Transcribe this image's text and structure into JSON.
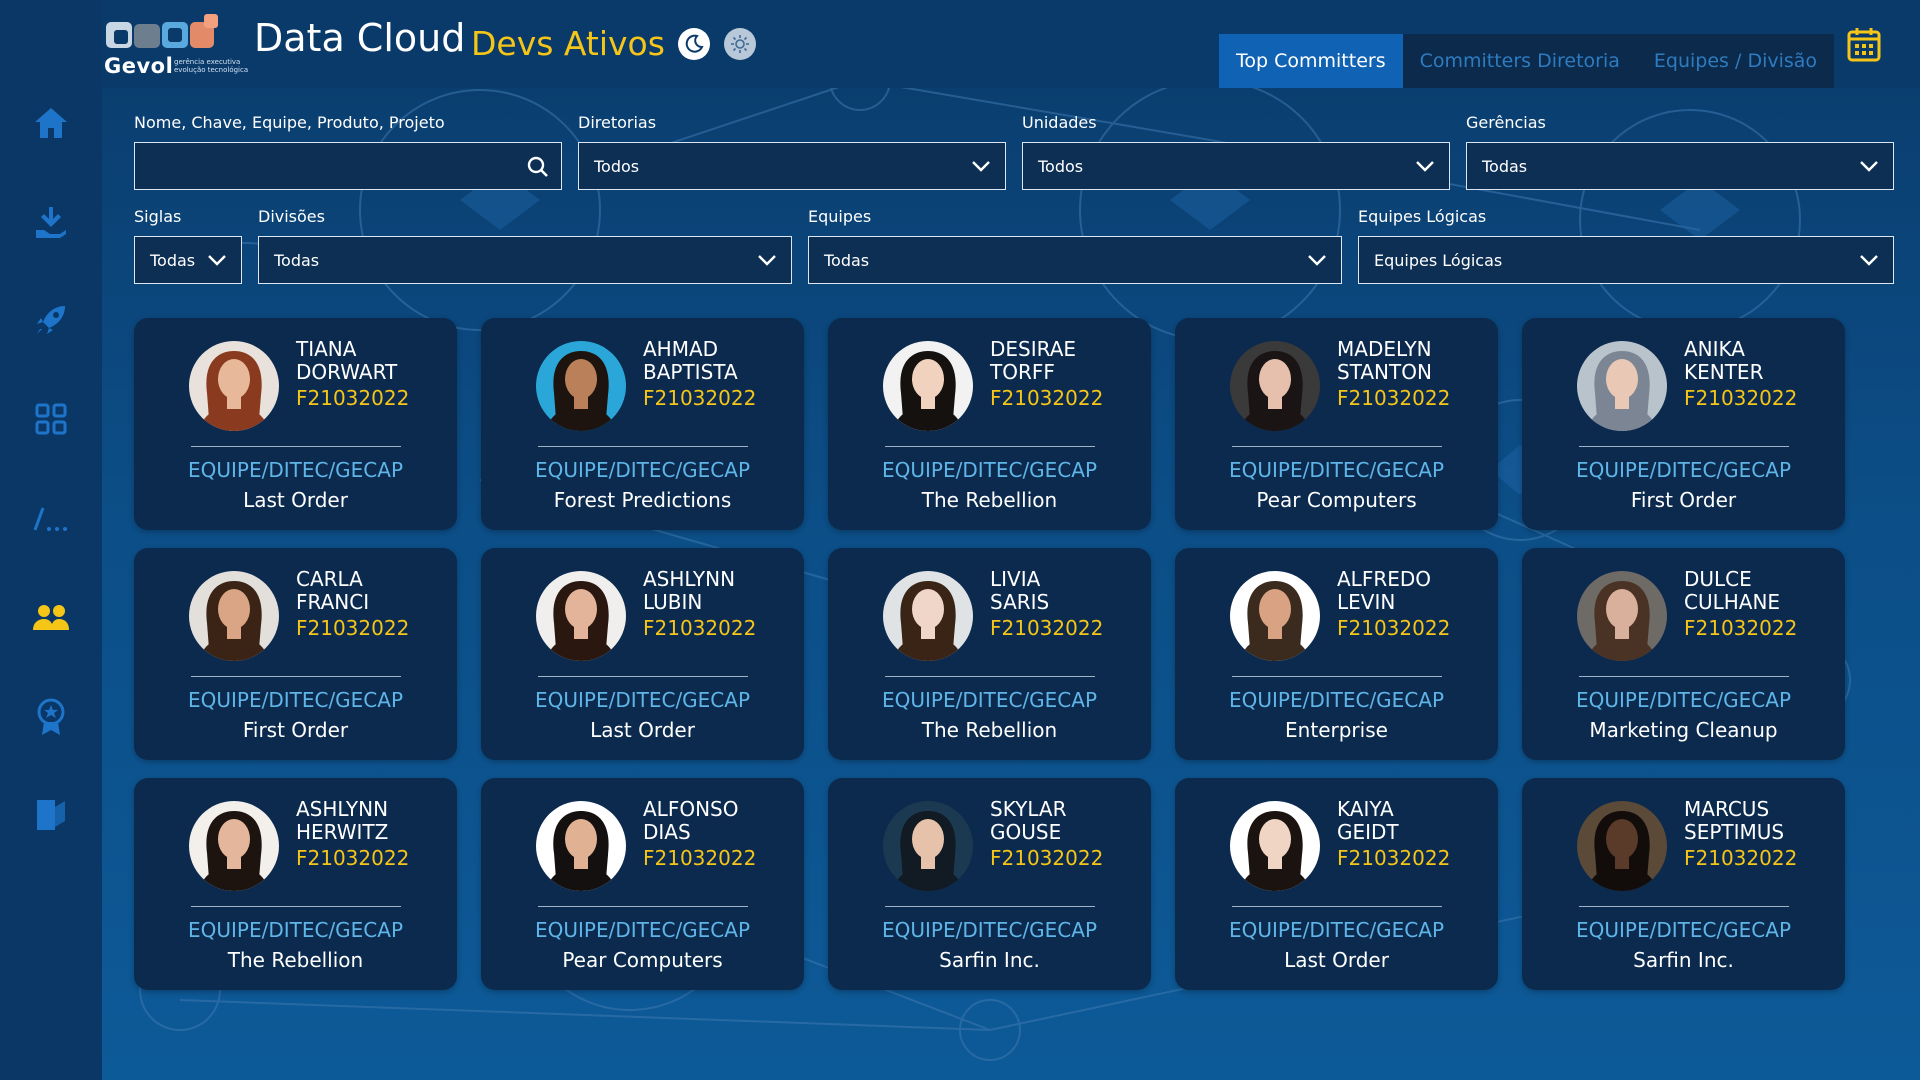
{
  "header": {
    "logo_text": "Gevol",
    "logo_subtitle": "gerência executiva evolução tecnológica",
    "app_title": "Data Cloud",
    "page_title": "Devs Ativos",
    "tabs": [
      "Top Committers",
      "Committers Diretoria",
      "Equipes / Divisão"
    ],
    "active_tab": "Top Committers"
  },
  "sidebar": {
    "items": [
      {
        "icon": "home-icon"
      },
      {
        "icon": "download-hand-icon"
      },
      {
        "icon": "rocket-icon"
      },
      {
        "icon": "apps-grid-icon"
      },
      {
        "icon": "code-slash-icon"
      },
      {
        "icon": "users-icon",
        "active": true
      },
      {
        "icon": "award-icon"
      },
      {
        "icon": "logout-icon"
      }
    ]
  },
  "filters": {
    "search": {
      "label": "Nome, Chave, Equipe, Produto, Projeto",
      "value": "",
      "placeholder": ""
    },
    "diretorias": {
      "label": "Diretorias",
      "value": "Todos"
    },
    "unidades": {
      "label": "Unidades",
      "value": "Todos"
    },
    "gerencias": {
      "label": "Gerências",
      "value": "Todas"
    },
    "siglas": {
      "label": "Siglas",
      "value": "Todas"
    },
    "divisoes": {
      "label": "Divisões",
      "value": "Todas"
    },
    "equipes": {
      "label": "Equipes",
      "value": "Todas"
    },
    "equipes_logicas": {
      "label": "Equipes Lógicas",
      "value": "Equipes Lógicas"
    }
  },
  "cards": [
    {
      "first": "TIANA",
      "last": "DORWART",
      "code": "F21032022",
      "team": "EQUIPE/DITEC/GECAP",
      "project": "Last Order",
      "skin": "#e8b89a",
      "hair": "#8a3a1e",
      "bg": "#e9e2dc"
    },
    {
      "first": "AHMAD",
      "last": "BAPTISTA",
      "code": "F21032022",
      "team": "EQUIPE/DITEC/GECAP",
      "project": "Forest Predictions",
      "skin": "#b9805a",
      "hair": "#1d1410",
      "bg": "#2aa7d8"
    },
    {
      "first": "DESIRAE",
      "last": "TORFF",
      "code": "F21032022",
      "team": "EQUIPE/DITEC/GECAP",
      "project": "The Rebellion",
      "skin": "#f0d2bf",
      "hair": "#15110f",
      "bg": "#f2f2f2"
    },
    {
      "first": "MADELYN",
      "last": "STANTON",
      "code": "F21032022",
      "team": "EQUIPE/DITEC/GECAP",
      "project": "Pear Computers",
      "skin": "#e6c0ad",
      "hair": "#1a1414",
      "bg": "#3a3a3a"
    },
    {
      "first": "ANIKA",
      "last": "KENTER",
      "code": "F21032022",
      "team": "EQUIPE/DITEC/GECAP",
      "project": "First Order",
      "skin": "#e9c8b6",
      "hair": "#7b8593",
      "bg": "#b9c3cc"
    },
    {
      "first": "CARLA",
      "last": "FRANCI",
      "code": "F21032022",
      "team": "EQUIPE/DITEC/GECAP",
      "project": "First Order",
      "skin": "#d9a584",
      "hair": "#3b2416",
      "bg": "#e3e0dc"
    },
    {
      "first": "ASHLYNN",
      "last": "LUBIN",
      "code": "F21032022",
      "team": "EQUIPE/DITEC/GECAP",
      "project": "Last Order",
      "skin": "#e3b39a",
      "hair": "#2a1710",
      "bg": "#f1efed"
    },
    {
      "first": "LIVIA",
      "last": "SARIS",
      "code": "F21032022",
      "team": "EQUIPE/DITEC/GECAP",
      "project": "The Rebellion",
      "skin": "#f0d6c8",
      "hair": "#3a2416",
      "bg": "#dfe3e6"
    },
    {
      "first": "ALFREDO",
      "last": "LEVIN",
      "code": "F21032022",
      "team": "EQUIPE/DITEC/GECAP",
      "project": "Enterprise",
      "skin": "#d9a282",
      "hair": "#3b2a1e",
      "bg": "#ffffff"
    },
    {
      "first": "DULCE",
      "last": "CULHANE",
      "code": "F21032022",
      "team": "EQUIPE/DITEC/GECAP",
      "project": "Marketing Cleanup",
      "skin": "#d8b09c",
      "hair": "#4a3324",
      "bg": "#6e6a66"
    },
    {
      "first": "ASHLYNN",
      "last": "HERWITZ",
      "code": "F21032022",
      "team": "EQUIPE/DITEC/GECAP",
      "project": "The Rebellion",
      "skin": "#e4b79c",
      "hair": "#1e140f",
      "bg": "#f3efeb"
    },
    {
      "first": "ALFONSO",
      "last": "DIAS",
      "code": "F21032022",
      "team": "EQUIPE/DITEC/GECAP",
      "project": "Pear Computers",
      "skin": "#e0b293",
      "hair": "#141010",
      "bg": "#ffffff"
    },
    {
      "first": "SKYLAR",
      "last": "GOUSE",
      "code": "F21032022",
      "team": "EQUIPE/DITEC/GECAP",
      "project": "Sarfin Inc.",
      "skin": "#e7c2ab",
      "hair": "#121a24",
      "bg": "#1b3a52"
    },
    {
      "first": "KAIYA",
      "last": "GEIDT",
      "code": "F21032022",
      "team": "EQUIPE/DITEC/GECAP",
      "project": "Last Order",
      "skin": "#f0d4c4",
      "hair": "#1b1310",
      "bg": "#ffffff"
    },
    {
      "first": "MARCUS",
      "last": "SEPTIMUS",
      "code": "F21032022",
      "team": "EQUIPE/DITEC/GECAP",
      "project": "Sarfin Inc.",
      "skin": "#5a3a28",
      "hair": "#120c0a",
      "bg": "#5c4a38"
    }
  ],
  "colors": {
    "accent_yellow": "#f5c518",
    "team_blue": "#5fb5e8",
    "card_bg": "#0b2a4e",
    "tab_active": "#0f62b4"
  }
}
